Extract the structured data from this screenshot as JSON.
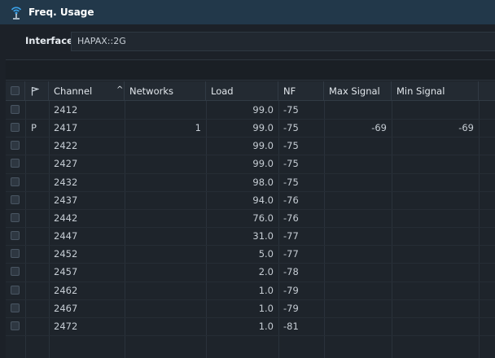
{
  "window": {
    "title": "Freq. Usage",
    "icon": "wifi-antenna-icon"
  },
  "interface": {
    "label": "Interface",
    "value": "HAPAX::2G"
  },
  "table": {
    "columns": {
      "checkbox": "",
      "flag_icon": "flag-icon",
      "channel": "Channel",
      "sort_indicator": "^",
      "networks": "Networks",
      "load": "Load",
      "nf": "NF",
      "max_signal": "Max Signal",
      "min_signal": "Min Signal"
    },
    "rows": [
      {
        "flag": "",
        "channel": "2412",
        "networks": "",
        "load": "99.0",
        "nf": "-75",
        "max_signal": "",
        "min_signal": ""
      },
      {
        "flag": "P",
        "channel": "2417",
        "networks": "1",
        "load": "99.0",
        "nf": "-75",
        "max_signal": "-69",
        "min_signal": "-69"
      },
      {
        "flag": "",
        "channel": "2422",
        "networks": "",
        "load": "99.0",
        "nf": "-75",
        "max_signal": "",
        "min_signal": ""
      },
      {
        "flag": "",
        "channel": "2427",
        "networks": "",
        "load": "99.0",
        "nf": "-75",
        "max_signal": "",
        "min_signal": ""
      },
      {
        "flag": "",
        "channel": "2432",
        "networks": "",
        "load": "98.0",
        "nf": "-75",
        "max_signal": "",
        "min_signal": ""
      },
      {
        "flag": "",
        "channel": "2437",
        "networks": "",
        "load": "94.0",
        "nf": "-76",
        "max_signal": "",
        "min_signal": ""
      },
      {
        "flag": "",
        "channel": "2442",
        "networks": "",
        "load": "76.0",
        "nf": "-76",
        "max_signal": "",
        "min_signal": ""
      },
      {
        "flag": "",
        "channel": "2447",
        "networks": "",
        "load": "31.0",
        "nf": "-77",
        "max_signal": "",
        "min_signal": ""
      },
      {
        "flag": "",
        "channel": "2452",
        "networks": "",
        "load": "5.0",
        "nf": "-77",
        "max_signal": "",
        "min_signal": ""
      },
      {
        "flag": "",
        "channel": "2457",
        "networks": "",
        "load": "2.0",
        "nf": "-78",
        "max_signal": "",
        "min_signal": ""
      },
      {
        "flag": "",
        "channel": "2462",
        "networks": "",
        "load": "1.0",
        "nf": "-79",
        "max_signal": "",
        "min_signal": ""
      },
      {
        "flag": "",
        "channel": "2467",
        "networks": "",
        "load": "1.0",
        "nf": "-79",
        "max_signal": "",
        "min_signal": ""
      },
      {
        "flag": "",
        "channel": "2472",
        "networks": "",
        "load": "1.0",
        "nf": "-81",
        "max_signal": "",
        "min_signal": ""
      }
    ]
  },
  "colors": {
    "titlebar": "#22384a",
    "background": "#1c2128",
    "accent_icon": "#3aa0e6"
  }
}
